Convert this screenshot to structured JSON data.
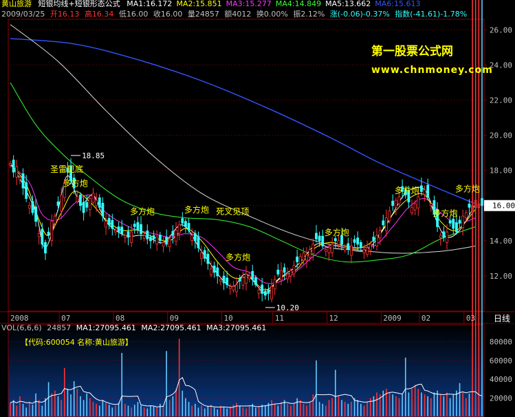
{
  "header": {
    "stock_name": "黄山旅游",
    "formula": "短银均线+短银形态公式",
    "ma_values": [
      {
        "label": "MA1:16.172",
        "color": "#ffffff"
      },
      {
        "label": "MA2:15.851",
        "color": "#ffff00"
      },
      {
        "label": "MA3:15.277",
        "color": "#ff33ff"
      },
      {
        "label": "MA4:14.849",
        "color": "#33ff33"
      },
      {
        "label": "MA5:13.662",
        "color": "#ffffff"
      },
      {
        "label": "MA6:15.613",
        "color": "#3355ff"
      }
    ],
    "quote": {
      "date": "2009/03/25",
      "open": "开16.13",
      "high": "高16.34",
      "low": "低16.00",
      "close": "收16.00",
      "volume": "量24857",
      "amount": "额4012",
      "turnover": "换0.00%",
      "amplitude": "振2.12%",
      "change": "涨(-0.06)-0.37%",
      "index": "指数(-41.61)-1.78%"
    }
  },
  "watermark": {
    "title": "第一股票公式网",
    "url": "www.chnmoney.com"
  },
  "volume_header": {
    "label": "VOL(6,6,6)",
    "value": "24857",
    "ma1": "MA1:27095.461",
    "ma2": "MA2:27095.461",
    "ma3": "MA3:27095.461"
  },
  "volume_info": "【代码:600054 名称:黄山旅游】",
  "period_label": "日线",
  "current_price_tag": "16.00",
  "colors": {
    "up": "#ff3333",
    "down": "#33ffff",
    "grid": "#8b0000",
    "axis_text": "#c0c0c0",
    "ma1": "#ffffff",
    "ma2": "#ffff00",
    "ma3": "#ff33ff",
    "ma4": "#33ff33",
    "ma5": "#ffffff",
    "ma6": "#3355ff"
  },
  "chart_data": [
    {
      "type": "candlestick",
      "title": "黄山旅游",
      "y_ticks": [
        12.0,
        14.0,
        16.0,
        18.0,
        20.0,
        22.0,
        24.0,
        26.0
      ],
      "ylim": [
        10.0,
        26.6
      ],
      "x_month_labels": [
        {
          "label": "2008",
          "index": 0
        },
        {
          "label": "07",
          "index": 16
        },
        {
          "label": "08",
          "index": 33
        },
        {
          "label": "09",
          "index": 50
        },
        {
          "label": "10",
          "index": 67
        },
        {
          "label": "11",
          "index": 83
        },
        {
          "label": "12",
          "index": 100
        },
        {
          "label": "2009",
          "index": 117
        },
        {
          "label": "02",
          "index": 129
        },
        {
          "label": "03",
          "index": 143
        }
      ],
      "closes": [
        18.4,
        17.9,
        18.2,
        17.6,
        17.0,
        16.4,
        16.0,
        15.6,
        15.1,
        14.4,
        13.8,
        13.3,
        14.3,
        15.1,
        15.4,
        16.0,
        16.6,
        17.3,
        17.9,
        17.4,
        17.0,
        16.5,
        16.0,
        15.6,
        15.9,
        16.4,
        16.7,
        16.3,
        15.9,
        15.4,
        15.1,
        14.9,
        14.7,
        14.6,
        14.5,
        14.4,
        14.3,
        14.2,
        14.5,
        14.8,
        14.6,
        14.4,
        14.3,
        14.1,
        14.0,
        14.1,
        14.2,
        14.0,
        13.9,
        13.8,
        14.1,
        14.3,
        14.6,
        14.9,
        15.0,
        14.8,
        14.6,
        14.3,
        14.0,
        13.6,
        13.3,
        13.0,
        12.7,
        12.4,
        12.2,
        12.0,
        11.8,
        11.6,
        11.5,
        11.4,
        11.4,
        11.5,
        11.7,
        11.9,
        12.1,
        12.0,
        11.8,
        11.5,
        11.2,
        11.0,
        10.9,
        11.0,
        11.4,
        11.8,
        12.1,
        12.3,
        12.2,
        12.1,
        12.3,
        12.6,
        12.8,
        13.1,
        13.3,
        13.2,
        13.5,
        13.8,
        14.1,
        14.0,
        13.7,
        13.5,
        13.6,
        13.8,
        14.0,
        14.0,
        13.8,
        13.6,
        13.5,
        13.7,
        13.9,
        13.8,
        13.6,
        13.5,
        13.6,
        13.8,
        14.0,
        14.3,
        14.6,
        14.9,
        15.3,
        15.7,
        16.0,
        16.3,
        16.5,
        16.8,
        16.6,
        16.2,
        15.9,
        16.1,
        16.5,
        16.8,
        16.9,
        16.5,
        16.1,
        15.5,
        14.8,
        14.3,
        14.2,
        14.5,
        15.0,
        14.7,
        14.5,
        15.0,
        15.4,
        15.6,
        15.9,
        16.0,
        16.3,
        16.1,
        16.0
      ],
      "ma_series": [
        {
          "key": "ma6",
          "values": [
            [
              0,
              25.5
            ],
            [
              20,
              25.2
            ],
            [
              40,
              24.3
            ],
            [
              60,
              23.1
            ],
            [
              80,
              21.6
            ],
            [
              100,
              19.9
            ],
            [
              115,
              18.5
            ],
            [
              130,
              17.3
            ],
            [
              146,
              16.1
            ]
          ]
        },
        {
          "key": "ma5",
          "values": [
            [
              0,
              26.3
            ],
            [
              15,
              24.2
            ],
            [
              30,
              21.4
            ],
            [
              45,
              18.8
            ],
            [
              60,
              16.7
            ],
            [
              75,
              15.4
            ],
            [
              90,
              14.3
            ],
            [
              105,
              13.6
            ],
            [
              120,
              13.3
            ],
            [
              135,
              13.4
            ],
            [
              146,
              13.7
            ]
          ]
        },
        {
          "key": "ma4",
          "values": [
            [
              0,
              23.0
            ],
            [
              8,
              20.6
            ],
            [
              16,
              19.0
            ],
            [
              25,
              17.6
            ],
            [
              35,
              16.3
            ],
            [
              45,
              15.6
            ],
            [
              55,
              15.3
            ],
            [
              65,
              15.2
            ],
            [
              75,
              14.8
            ],
            [
              85,
              14.0
            ],
            [
              95,
              13.2
            ],
            [
              105,
              12.8
            ],
            [
              115,
              12.9
            ],
            [
              125,
              13.2
            ],
            [
              135,
              14.1
            ],
            [
              146,
              14.8
            ]
          ]
        },
        {
          "key": "ma3",
          "values": [
            [
              0,
              18.3
            ],
            [
              6,
              17.3
            ],
            [
              10,
              15.5
            ],
            [
              15,
              15.2
            ],
            [
              20,
              16.1
            ],
            [
              25,
              16.6
            ],
            [
              30,
              15.6
            ],
            [
              35,
              15.0
            ],
            [
              40,
              14.6
            ],
            [
              45,
              14.4
            ],
            [
              50,
              14.2
            ],
            [
              55,
              14.4
            ],
            [
              60,
              14.2
            ],
            [
              65,
              13.4
            ],
            [
              70,
              12.5
            ],
            [
              75,
              12.2
            ],
            [
              80,
              11.6
            ],
            [
              85,
              11.7
            ],
            [
              90,
              12.3
            ],
            [
              95,
              13.1
            ],
            [
              100,
              13.7
            ],
            [
              105,
              13.7
            ],
            [
              110,
              13.6
            ],
            [
              115,
              13.8
            ],
            [
              120,
              14.8
            ],
            [
              125,
              15.9
            ],
            [
              130,
              16.4
            ],
            [
              135,
              15.6
            ],
            [
              140,
              15.0
            ],
            [
              146,
              15.3
            ]
          ]
        },
        {
          "key": "ma2",
          "values": [
            [
              0,
              18.4
            ],
            [
              5,
              17.2
            ],
            [
              9,
              15.2
            ],
            [
              12,
              14.3
            ],
            [
              16,
              15.6
            ],
            [
              20,
              16.8
            ],
            [
              25,
              16.2
            ],
            [
              30,
              15.2
            ],
            [
              35,
              14.6
            ],
            [
              40,
              14.6
            ],
            [
              45,
              14.2
            ],
            [
              50,
              14.0
            ],
            [
              55,
              14.7
            ],
            [
              60,
              14.0
            ],
            [
              65,
              12.8
            ],
            [
              70,
              11.9
            ],
            [
              75,
              11.9
            ],
            [
              80,
              11.2
            ],
            [
              85,
              11.9
            ],
            [
              90,
              12.4
            ],
            [
              95,
              13.5
            ],
            [
              100,
              13.9
            ],
            [
              105,
              13.7
            ],
            [
              110,
              13.6
            ],
            [
              115,
              14.2
            ],
            [
              120,
              15.5
            ],
            [
              125,
              16.4
            ],
            [
              130,
              16.6
            ],
            [
              135,
              15.1
            ],
            [
              140,
              14.6
            ],
            [
              146,
              15.8
            ]
          ]
        },
        {
          "key": "ma1",
          "values": [
            [
              0,
              18.4
            ],
            [
              4,
              17.2
            ],
            [
              8,
              15.6
            ],
            [
              11,
              13.6
            ],
            [
              15,
              15.8
            ],
            [
              18,
              17.7
            ],
            [
              22,
              16.1
            ],
            [
              26,
              16.6
            ],
            [
              30,
              15.1
            ],
            [
              36,
              14.3
            ],
            [
              42,
              14.3
            ],
            [
              48,
              13.9
            ],
            [
              54,
              14.9
            ],
            [
              60,
              13.4
            ],
            [
              66,
              11.9
            ],
            [
              70,
              11.4
            ],
            [
              74,
              12.1
            ],
            [
              80,
              11.0
            ],
            [
              84,
              11.8
            ],
            [
              90,
              12.6
            ],
            [
              96,
              13.8
            ],
            [
              100,
              13.6
            ],
            [
              106,
              13.5
            ],
            [
              112,
              13.5
            ],
            [
              118,
              14.9
            ],
            [
              124,
              16.7
            ],
            [
              130,
              16.9
            ],
            [
              134,
              15.0
            ],
            [
              137,
              14.2
            ],
            [
              141,
              14.6
            ],
            [
              146,
              16.1
            ]
          ]
        }
      ],
      "annotations": [
        {
          "text": "18.85",
          "index": 19,
          "price": 18.85
        },
        {
          "text": "10.20",
          "index": 80,
          "price": 10.2
        },
        {
          "text": "圣雷见底",
          "index": 16,
          "price": 17.9
        },
        {
          "text": "多方炮",
          "index": 20,
          "price": 17.1
        },
        {
          "text": "多方炮",
          "index": 41,
          "price": 15.5
        },
        {
          "text": "多方炮",
          "index": 58,
          "price": 15.6
        },
        {
          "text": "死叉见顶",
          "index": 68,
          "price": 15.5
        },
        {
          "text": "多方炮",
          "index": 71,
          "price": 12.9
        },
        {
          "text": "多方炮",
          "index": 102,
          "price": 14.3
        },
        {
          "text": "多方炮",
          "index": 124,
          "price": 16.7
        },
        {
          "text": "多方炮",
          "index": 136,
          "price": 15.4
        },
        {
          "text": "多方炮",
          "index": 143,
          "price": 16.8
        }
      ]
    },
    {
      "type": "bar",
      "title": "VOL(6,6,6)",
      "y_ticks": [
        20000,
        40000,
        60000,
        80000
      ],
      "ylim": [
        0,
        92000
      ],
      "volumes": [
        15000,
        18000,
        12000,
        22000,
        14000,
        10000,
        16000,
        13000,
        25000,
        18000,
        12000,
        20000,
        37000,
        25000,
        28000,
        22000,
        18000,
        52000,
        30000,
        24000,
        38000,
        30000,
        22000,
        18000,
        25000,
        20000,
        16000,
        14000,
        12000,
        18000,
        15000,
        13000,
        10000,
        12000,
        15000,
        11000,
        14000,
        12000,
        10000,
        13000,
        16000,
        12000,
        10000,
        9000,
        12000,
        11000,
        10000,
        14000,
        12000,
        10000,
        18000,
        22000,
        30000,
        35000,
        28000,
        20000,
        16000,
        12000,
        14000,
        10000,
        12000,
        9000,
        11000,
        13000,
        10000,
        8000,
        12000,
        10000,
        9000,
        11000,
        13000,
        15000,
        12000,
        10000,
        9000,
        12000,
        14000,
        10000,
        11000,
        13000,
        12000,
        15000,
        18000,
        14000,
        12000,
        16000,
        18000,
        14000,
        12000,
        15000,
        20000,
        18000,
        14000,
        12000,
        16000,
        24000,
        20000,
        16000,
        14000,
        12000,
        18000,
        20000,
        24000,
        22000,
        18000,
        16000,
        14000,
        16000,
        20000,
        18000,
        14000,
        12000,
        16000,
        20000,
        22000,
        26000,
        24000,
        28000,
        30000,
        26000,
        24000,
        22000,
        20000,
        24000,
        28000,
        26000,
        30000,
        34000,
        30000,
        26000,
        24000,
        22000,
        20000,
        26000,
        28000,
        24000,
        22000,
        26000,
        20000,
        24000,
        28000,
        30000,
        26000,
        20000,
        24857
      ],
      "spikes": [
        {
          "index": 35,
          "value": 68000
        },
        {
          "index": 49,
          "value": 70000
        },
        {
          "index": 53,
          "value": 83000
        },
        {
          "index": 96,
          "value": 60000
        },
        {
          "index": 102,
          "value": 50000
        },
        {
          "index": 124,
          "value": 63000
        },
        {
          "index": 141,
          "value": 36000
        }
      ]
    }
  ]
}
